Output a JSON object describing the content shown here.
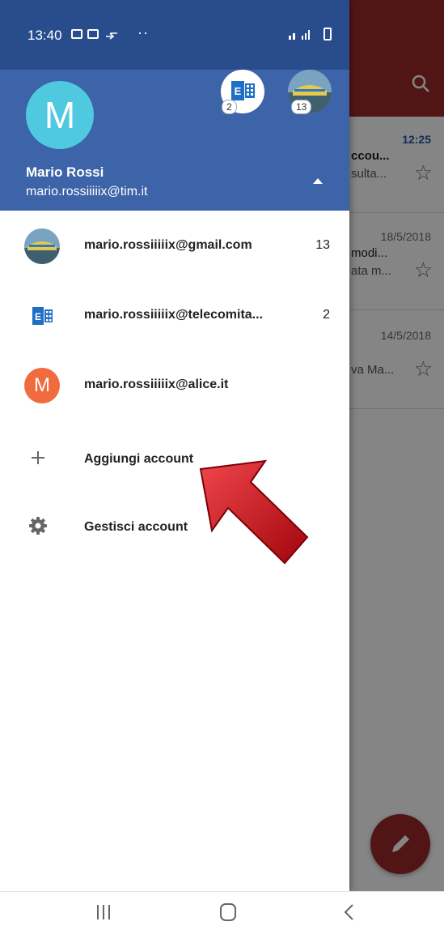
{
  "status_bar": {
    "time": "13:40"
  },
  "drawer": {
    "header": {
      "avatar_letter": "M",
      "user_name": "Mario Rossi",
      "user_email": "mario.rossiiiiix@tim.it",
      "exchange_badge": "2",
      "photo_badge": "13"
    },
    "accounts": [
      {
        "email": "mario.rossiiiiix@gmail.com",
        "count": "13",
        "avatar": "photo"
      },
      {
        "email": "mario.rossiiiiix@telecomita...",
        "count": "2",
        "avatar": "exchange"
      },
      {
        "email": "mario.rossiiiiix@alice.it",
        "count": "",
        "avatar": "M"
      }
    ],
    "menu": [
      {
        "label": "Aggiungi account",
        "icon": "plus-icon"
      },
      {
        "label": "Gestisci account",
        "icon": "gear-icon"
      }
    ]
  },
  "background_list": [
    {
      "date": "12:25",
      "line1": "ccou...",
      "line2": "sulta..."
    },
    {
      "date": "18/5/2018",
      "line1": "modi...",
      "line2": "ata m..."
    },
    {
      "date": "14/5/2018",
      "line1": "",
      "line2": "va Ma..."
    }
  ],
  "colors": {
    "header_blue": "#3d63a8",
    "status_blue": "#294c8c",
    "app_red": "#9e2a2a",
    "avatar_cyan": "#4ec9e0",
    "avatar_orange": "#f06c3f",
    "arrow_red": "#c40a12"
  }
}
